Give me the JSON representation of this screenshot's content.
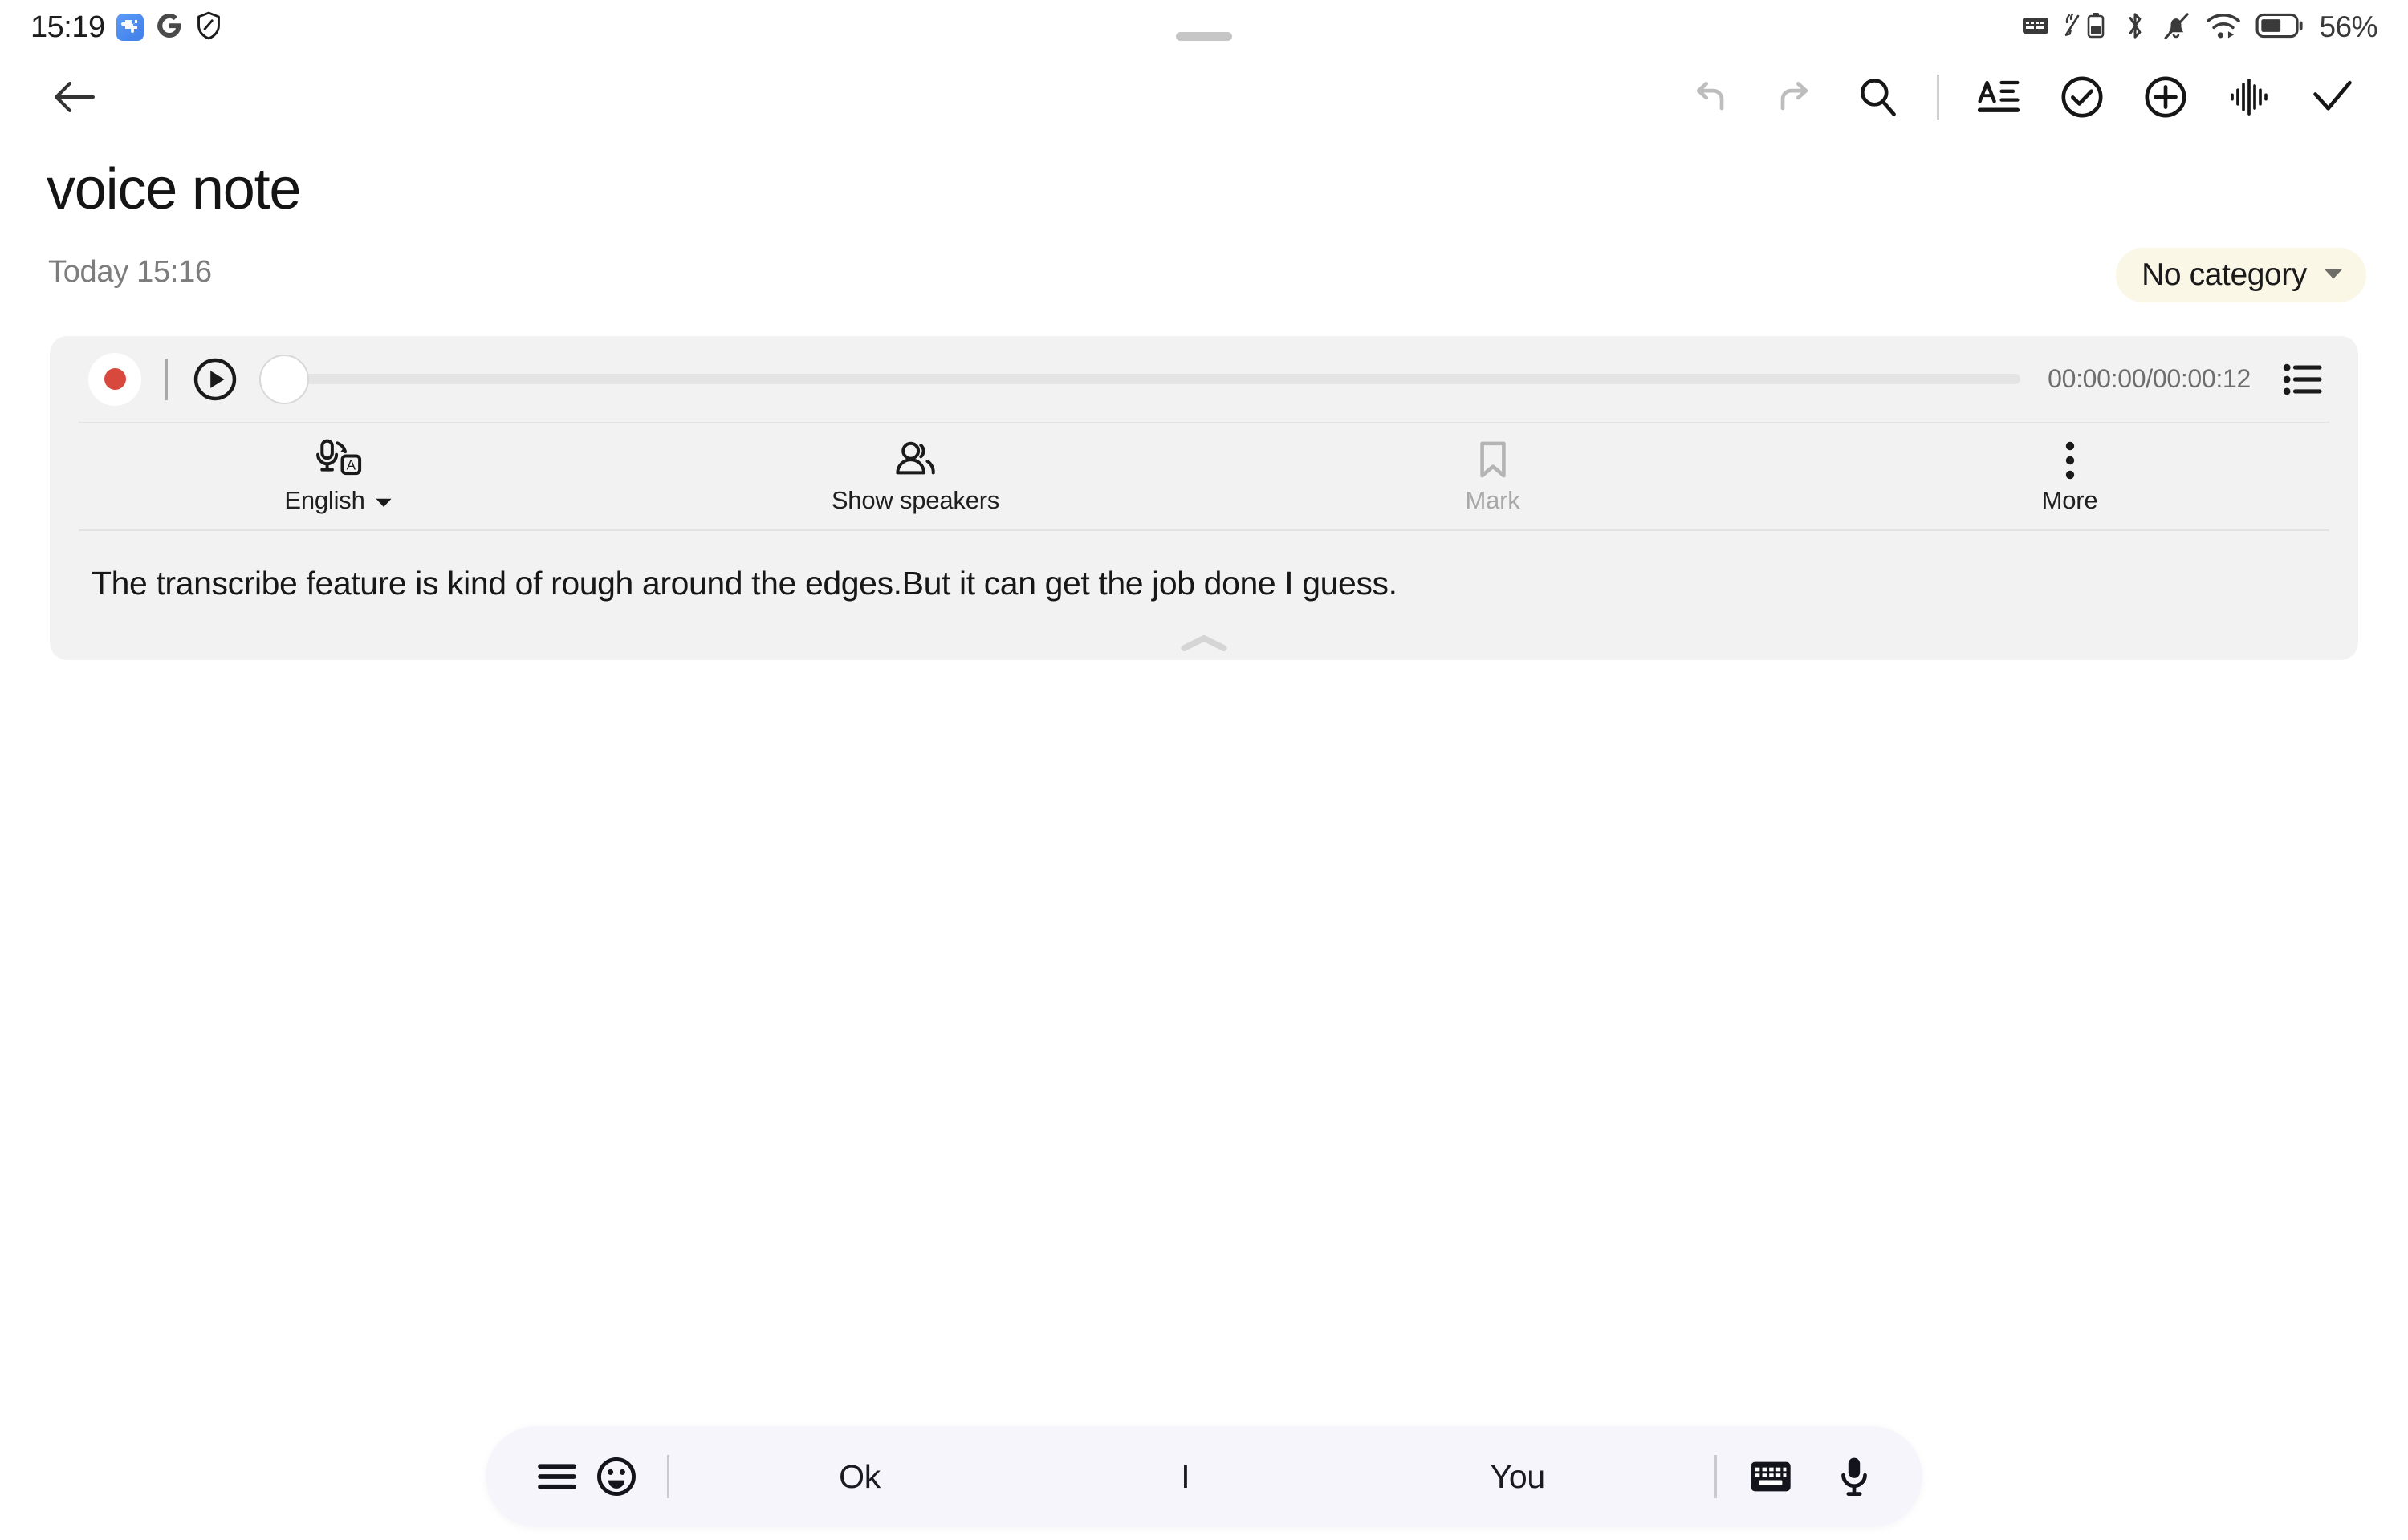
{
  "status_bar": {
    "time": "15:19",
    "left_icons": [
      "puzzle-extension-icon",
      "google-g-icon",
      "shield-icon"
    ],
    "right_icons": [
      "keyboard-icon",
      "stylus-battery-icon",
      "bluetooth-icon",
      "mute-bell-icon",
      "wifi-icon",
      "battery-icon"
    ],
    "battery_percent": "56%"
  },
  "toolbar": {
    "back_icon": "back-arrow-icon",
    "undo_icon": "undo-icon",
    "redo_icon": "redo-icon",
    "search_icon": "search-icon",
    "format_icon": "text-format-icon",
    "checklist_icon": "check-circle-icon",
    "add_icon": "plus-circle-icon",
    "waveform_icon": "waveform-icon",
    "done_icon": "checkmark-icon"
  },
  "note": {
    "title": "voice note",
    "date": "Today 15:16",
    "category": "No category",
    "category_caret": "chevron-down-icon"
  },
  "player": {
    "record_icon": "record-icon",
    "play_icon": "play-icon",
    "time": "00:00:00/00:00:12",
    "current_time": "00:00:00",
    "total_time": "00:00:12",
    "progress_percent": 0,
    "list_icon": "bullet-list-icon"
  },
  "actions": [
    {
      "label": "English",
      "icon": "mic-translate-icon",
      "caret": "chevron-down-icon",
      "disabled": false,
      "has_caret": true
    },
    {
      "label": "Show speakers",
      "icon": "people-icon",
      "disabled": false,
      "has_caret": false
    },
    {
      "label": "Mark",
      "icon": "bookmark-icon",
      "disabled": true,
      "has_caret": false
    },
    {
      "label": "More",
      "icon": "more-vertical-icon",
      "disabled": false,
      "has_caret": false
    }
  ],
  "transcript": {
    "text": "The transcribe feature is kind of rough around the edges.But it can get the job done I guess.",
    "collapse_icon": "chevron-up-icon"
  },
  "suggestion_bar": {
    "menu_icon": "hamburger-menu-icon",
    "emoji_icon": "emoji-face-icon",
    "words": [
      "Ok",
      "I",
      "You"
    ],
    "keyboard_icon": "keyboard-icon",
    "mic_icon": "microphone-icon"
  },
  "colors": {
    "card_background": "#f2f2f2",
    "record_red": "#d9483c",
    "category_chip": "#faf7e7",
    "suggestion_bar": "#f7f5fc",
    "text_primary": "#171717",
    "text_muted": "#7d7d7d",
    "disabled": "#a8a8a8"
  }
}
